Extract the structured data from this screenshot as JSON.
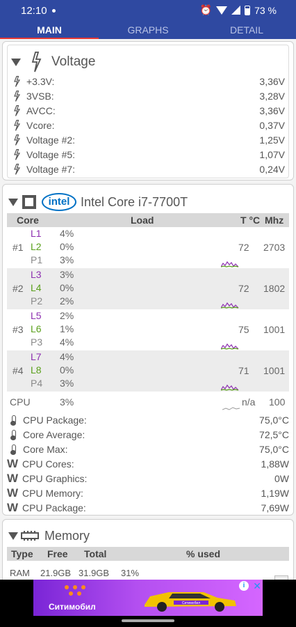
{
  "status_bar": {
    "time": "12:10",
    "battery": "73 %"
  },
  "tabs": [
    {
      "label": "MAIN",
      "active": true
    },
    {
      "label": "GRAPHS",
      "active": false
    },
    {
      "label": "DETAIL",
      "active": false
    }
  ],
  "voltage": {
    "title": "Voltage",
    "rows": [
      {
        "label": "+3.3V:",
        "value": "3,36V"
      },
      {
        "label": "3VSB:",
        "value": "3,28V"
      },
      {
        "label": "AVCC:",
        "value": "3,36V"
      },
      {
        "label": "Vcore:",
        "value": "0,37V"
      },
      {
        "label": "Voltage #2:",
        "value": "1,25V"
      },
      {
        "label": "Voltage #5:",
        "value": "1,07V"
      },
      {
        "label": "Voltage #7:",
        "value": "0,24V"
      }
    ]
  },
  "cpu": {
    "brand": "intel",
    "title": "Intel Core i7-7700T",
    "headers": {
      "core": "Core",
      "load": "Load",
      "temp": "T °C",
      "mhz": "Mhz"
    },
    "cores": [
      {
        "num": "#1",
        "subs": [
          {
            "name": "L1",
            "pct": "4%"
          },
          {
            "name": "L2",
            "pct": "0%"
          },
          {
            "name": "P1",
            "pct": "3%"
          }
        ],
        "temp": "72",
        "mhz": "2703"
      },
      {
        "num": "#2",
        "subs": [
          {
            "name": "L3",
            "pct": "3%"
          },
          {
            "name": "L4",
            "pct": "0%"
          },
          {
            "name": "P2",
            "pct": "2%"
          }
        ],
        "temp": "72",
        "mhz": "1802"
      },
      {
        "num": "#3",
        "subs": [
          {
            "name": "L5",
            "pct": "2%"
          },
          {
            "name": "L6",
            "pct": "1%"
          },
          {
            "name": "P3",
            "pct": "4%"
          }
        ],
        "temp": "75",
        "mhz": "1001"
      },
      {
        "num": "#4",
        "subs": [
          {
            "name": "L7",
            "pct": "4%"
          },
          {
            "name": "L8",
            "pct": "0%"
          },
          {
            "name": "P4",
            "pct": "3%"
          }
        ],
        "temp": "71",
        "mhz": "1001"
      }
    ],
    "total": {
      "label": "CPU",
      "pct": "3%",
      "temp": "n/a",
      "mhz": "100"
    },
    "temps": [
      {
        "label": "CPU Package:",
        "value": "75,0°C"
      },
      {
        "label": "Core Average:",
        "value": "72,5°C"
      },
      {
        "label": "Core Max:",
        "value": "75,0°C"
      }
    ],
    "power": [
      {
        "label": "CPU Cores:",
        "value": "1,88W"
      },
      {
        "label": "CPU Graphics:",
        "value": "0W"
      },
      {
        "label": "CPU Memory:",
        "value": "1,19W"
      },
      {
        "label": "CPU Package:",
        "value": "7,69W"
      }
    ]
  },
  "memory": {
    "title": "Memory",
    "headers": {
      "type": "Type",
      "free": "Free",
      "total": "Total",
      "used": "% used"
    },
    "row": {
      "type": "RAM",
      "free": "21.9GB",
      "total": "31.9GB",
      "used": "31%"
    }
  },
  "ad": {
    "brand_text": "Ситимобил",
    "car_text": "Ситимобил"
  },
  "colors": {
    "header_blue": "#2f49a1",
    "tab_indicator": "#e53935",
    "thread_purple": "#8d2fb0",
    "thread_green": "#5aa01c",
    "intel_blue": "#0071c5"
  }
}
